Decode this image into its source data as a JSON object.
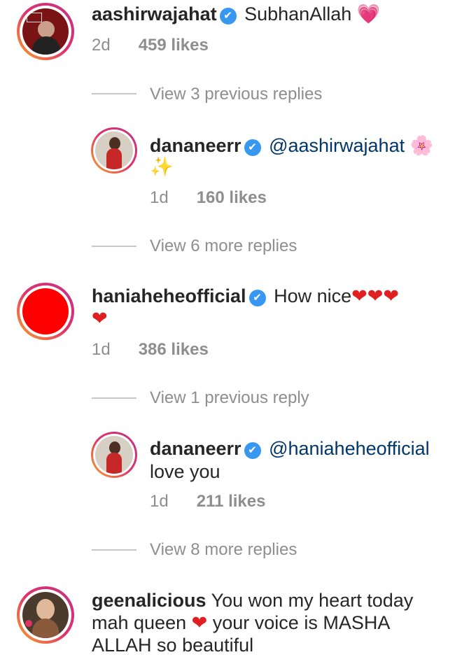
{
  "comments": [
    {
      "username": "aashirwajahat",
      "text": "SubhanAllah",
      "emoji": "💗",
      "time": "2d",
      "likes": "459 likes"
    },
    {
      "username": "dananeerr",
      "mention": "@aashirwajahat",
      "emoji": "🌸",
      "emoji2": "✨",
      "time": "1d",
      "likes": "160 likes"
    },
    {
      "username": "haniaheheofficial",
      "text": "How nice",
      "hearts": "❤❤❤",
      "heart2": "❤",
      "time": "1d",
      "likes": "386 likes"
    },
    {
      "username": "dananeerr",
      "mention": "@haniaheheofficial",
      "text": "love you",
      "time": "1d",
      "likes": "211 likes"
    },
    {
      "username": "geenalicious",
      "text1": "You won my heart today",
      "text2a": "mah queen",
      "heart": "❤",
      "text2b": "your voice is MASHA",
      "text3": "ALLAH so beautiful"
    }
  ],
  "view": {
    "v1": "View 3 previous replies",
    "v2": "View 6 more replies",
    "v3": "View 1 previous reply",
    "v4": "View 8 more replies"
  },
  "icons": {
    "verified": "✔"
  }
}
